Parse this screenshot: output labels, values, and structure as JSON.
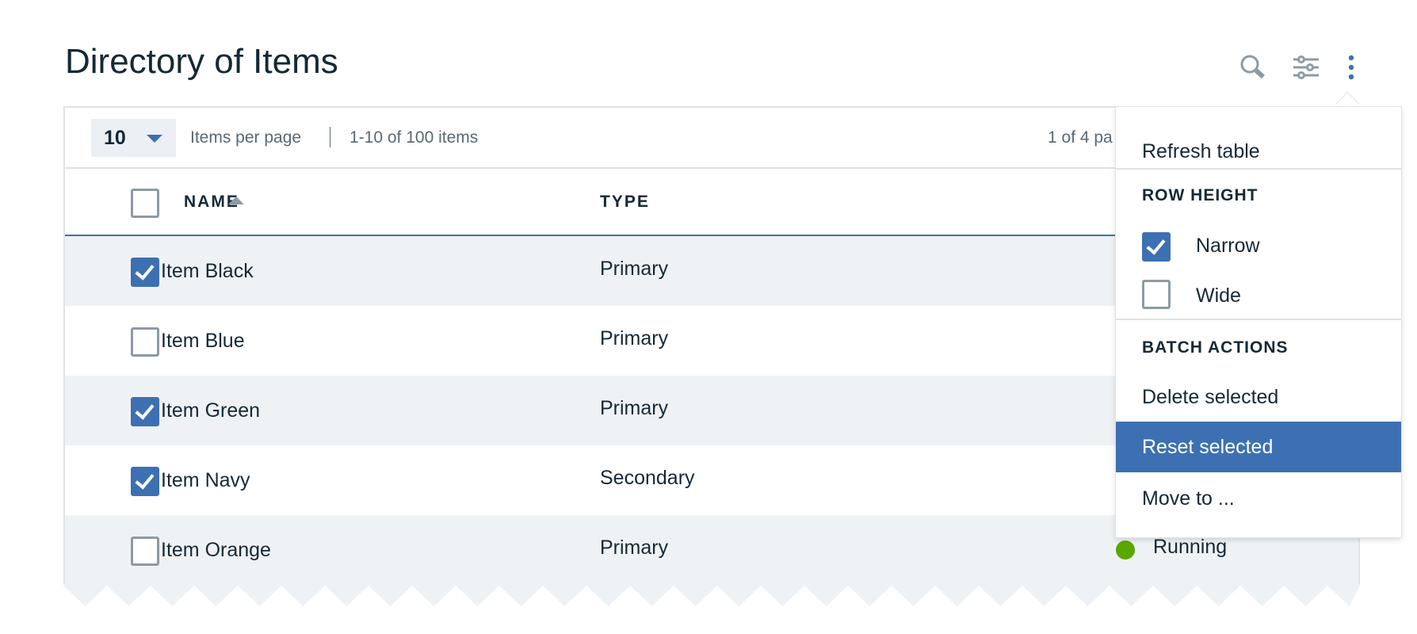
{
  "header": {
    "title": "Directory of Items",
    "icons": [
      "search-icon",
      "filter-sliders-icon",
      "overflow-menu-icon"
    ]
  },
  "toolbar": {
    "per_page_value": "10",
    "per_page_label": "Items per page",
    "range_label": "1-10 of 100 items",
    "page_label": "1 of 4 pa"
  },
  "table": {
    "columns": [
      "NAME",
      "TYPE"
    ],
    "rows": [
      {
        "name": "Item Black",
        "type": "Primary",
        "checked": true
      },
      {
        "name": "Item Blue",
        "type": "Primary",
        "checked": false
      },
      {
        "name": "Item Green",
        "type": "Primary",
        "checked": true
      },
      {
        "name": "Item Navy",
        "type": "Secondary",
        "checked": true
      },
      {
        "name": "Item Orange",
        "type": "Primary",
        "checked": false,
        "status": "Running",
        "status_color": "#5aa700"
      }
    ]
  },
  "menu": {
    "refresh": "Refresh table",
    "row_height_heading": "ROW HEIGHT",
    "narrow": "Narrow",
    "narrow_checked": true,
    "wide": "Wide",
    "wide_checked": false,
    "batch_heading": "BATCH ACTIONS",
    "delete": "Delete selected",
    "reset": "Reset selected",
    "move": "Move to ..."
  },
  "colors": {
    "accent": "#3d70b2",
    "text": "#152935",
    "stripe": "#eff2f5",
    "running": "#5aa700"
  }
}
